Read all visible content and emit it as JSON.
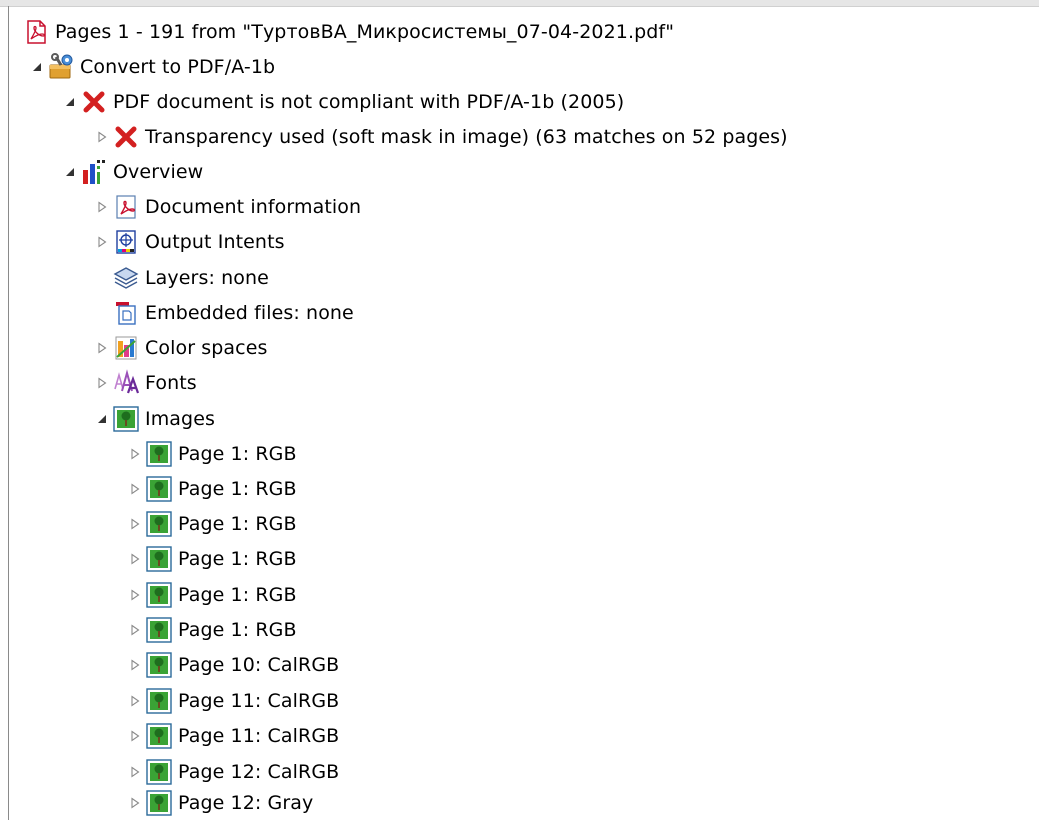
{
  "tree": {
    "root": {
      "label": "Pages 1 - 191 from \"ТуртовВА_Микросистемы_07-04-2021.pdf\"",
      "icon": "pdf-document-icon"
    },
    "convert": {
      "label": "Convert to PDF/A-1b",
      "icon": "fix-tools-icon",
      "state": "expanded"
    },
    "not_compliant": {
      "label": "PDF document is not compliant with PDF/A-1b (2005)",
      "icon": "error-x-icon",
      "state": "expanded"
    },
    "transparency": {
      "label": "Transparency used (soft mask in image) (63 matches on 52 pages)",
      "icon": "error-x-icon",
      "state": "collapsed"
    },
    "overview": {
      "label": "Overview",
      "icon": "overview-bars-icon",
      "state": "expanded"
    },
    "doc_info": {
      "label": "Document information",
      "icon": "pdf-document-icon",
      "state": "collapsed"
    },
    "output_intents": {
      "label": "Output Intents",
      "icon": "output-intents-icon",
      "state": "collapsed"
    },
    "layers": {
      "label": "Layers: none",
      "icon": "layers-icon"
    },
    "embedded_files": {
      "label": "Embedded files: none",
      "icon": "embedded-files-icon"
    },
    "color_spaces": {
      "label": "Color spaces",
      "icon": "color-spaces-icon",
      "state": "collapsed"
    },
    "fonts": {
      "label": "Fonts",
      "icon": "fonts-icon",
      "state": "collapsed"
    },
    "images": {
      "label": "Images",
      "icon": "image-icon",
      "state": "expanded"
    },
    "image_items": [
      {
        "label": "Page 1: RGB",
        "icon": "image-icon",
        "state": "collapsed"
      },
      {
        "label": "Page 1: RGB",
        "icon": "image-icon",
        "state": "collapsed"
      },
      {
        "label": "Page 1: RGB",
        "icon": "image-icon",
        "state": "collapsed"
      },
      {
        "label": "Page 1: RGB",
        "icon": "image-icon",
        "state": "collapsed"
      },
      {
        "label": "Page 1: RGB",
        "icon": "image-icon",
        "state": "collapsed"
      },
      {
        "label": "Page 1: RGB",
        "icon": "image-icon",
        "state": "collapsed"
      },
      {
        "label": "Page 10: CalRGB",
        "icon": "image-icon",
        "state": "collapsed"
      },
      {
        "label": "Page 11: CalRGB",
        "icon": "image-icon",
        "state": "collapsed"
      },
      {
        "label": "Page 11: CalRGB",
        "icon": "image-icon",
        "state": "collapsed"
      },
      {
        "label": "Page 12: CalRGB",
        "icon": "image-icon",
        "state": "collapsed"
      },
      {
        "label": "Page 12: Gray",
        "icon": "image-icon",
        "state": "collapsed"
      }
    ]
  },
  "colors": {
    "error_red": "#d32020",
    "image_green": "#3aa335",
    "pdf_red": "#c8102e",
    "expander_gray": "#8a8a8a"
  }
}
